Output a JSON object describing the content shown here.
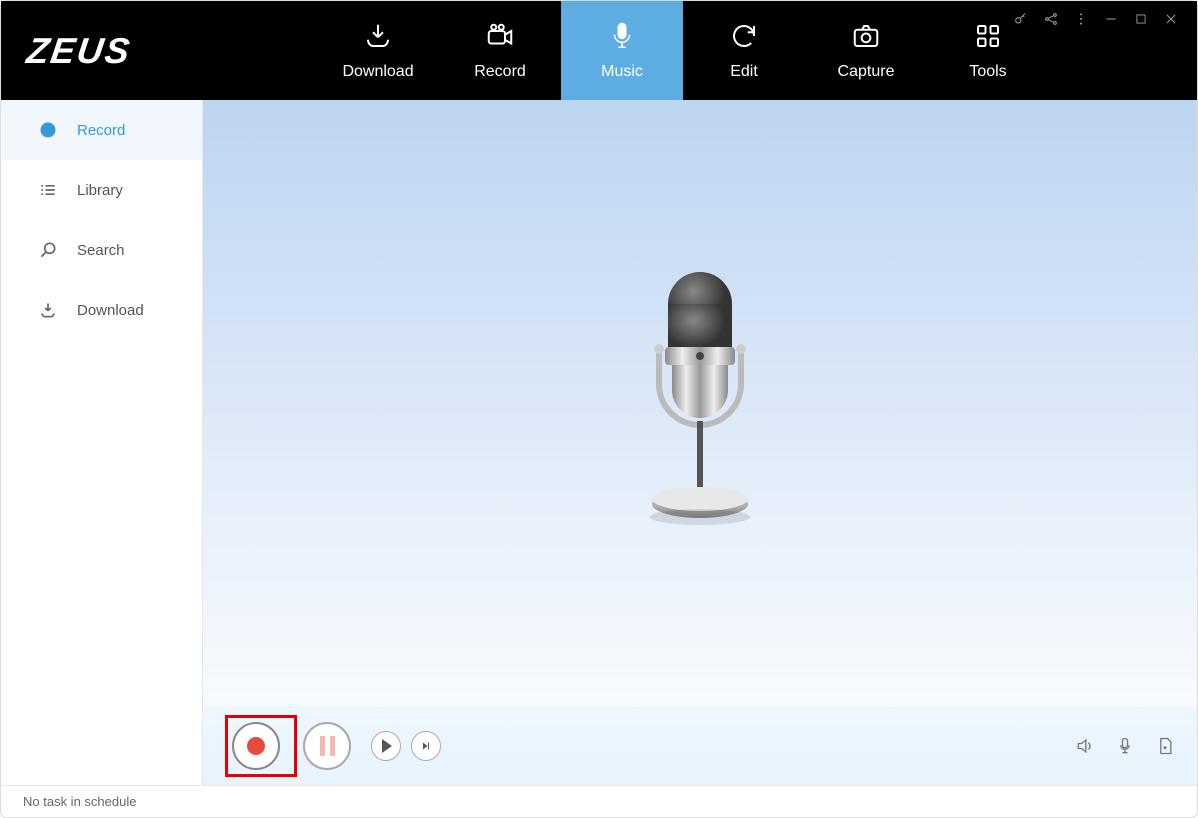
{
  "app": {
    "logo": "ZEUS"
  },
  "nav": {
    "items": [
      {
        "label": "Download"
      },
      {
        "label": "Record"
      },
      {
        "label": "Music"
      },
      {
        "label": "Edit"
      },
      {
        "label": "Capture"
      },
      {
        "label": "Tools"
      }
    ],
    "activeIndex": 2
  },
  "sidebar": {
    "items": [
      {
        "label": "Record"
      },
      {
        "label": "Library"
      },
      {
        "label": "Search"
      },
      {
        "label": "Download"
      }
    ],
    "activeIndex": 0
  },
  "status": {
    "text": "No task in schedule"
  }
}
